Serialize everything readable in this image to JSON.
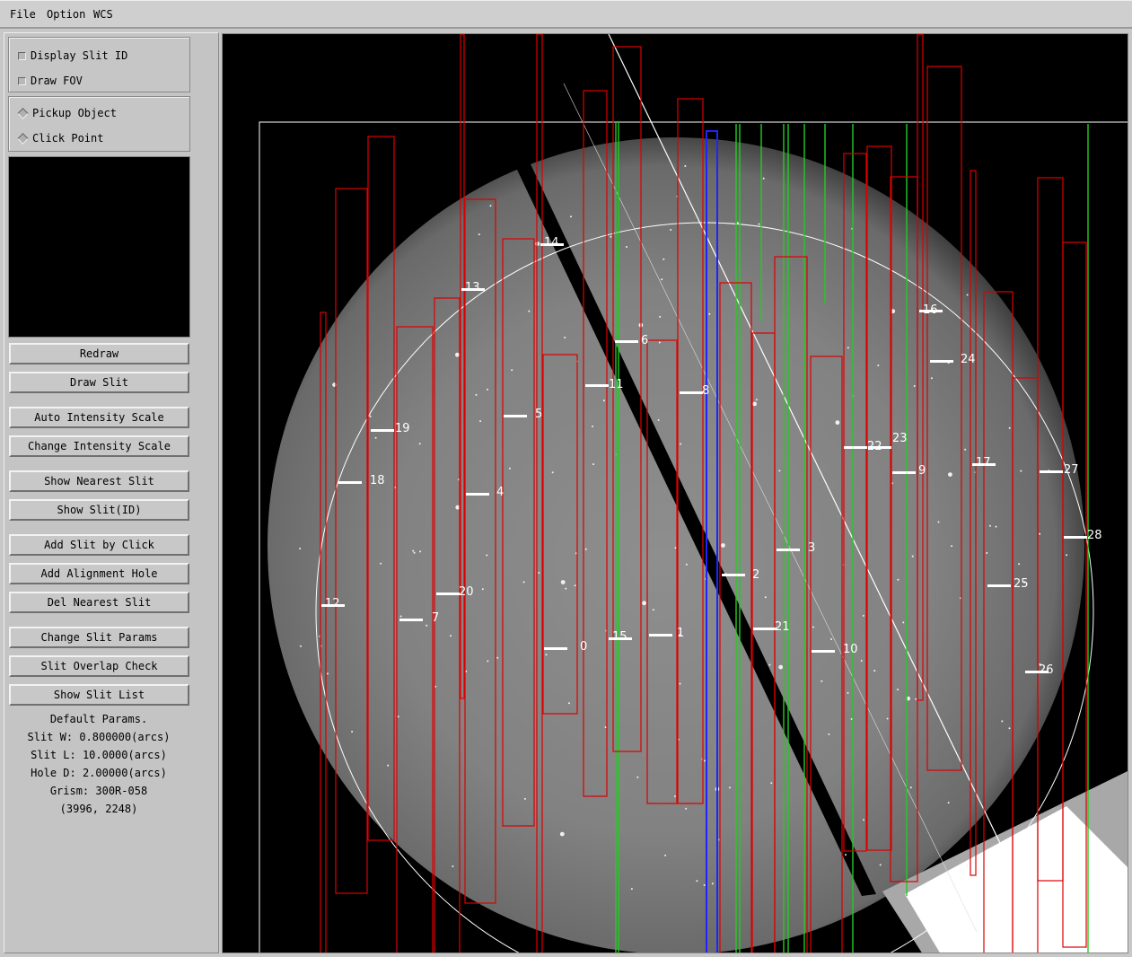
{
  "menu": [
    "File",
    "Option",
    "WCS"
  ],
  "options": {
    "display_slit_id": "Display Slit ID",
    "draw_fov": "Draw FOV",
    "pickup_object": "Pickup Object",
    "click_point": "Click Point"
  },
  "buttons": {
    "redraw": "Redraw",
    "draw_slit": "Draw Slit",
    "auto_intensity": "Auto Intensity Scale",
    "change_intensity": "Change Intensity Scale",
    "show_nearest": "Show Nearest Slit",
    "show_slit_id": "Show Slit(ID)",
    "add_slit_click": "Add Slit by Click",
    "add_alignment": "Add Alignment Hole",
    "del_nearest": "Del Nearest Slit",
    "change_params": "Change Slit Params",
    "overlap_check": "Slit Overlap Check",
    "show_list": "Show Slit List"
  },
  "params": {
    "heading": "Default Params.",
    "slit_w": "Slit W: 0.800000(arcs)",
    "slit_l": "Slit L: 10.0000(arcs)",
    "hole_d": "Hole D: 2.00000(arcs)",
    "grism": "Grism: 300R-058",
    "coords": "(3996, 2248)"
  },
  "slit_labels": [
    "0",
    "1",
    "2",
    "3",
    "4",
    "5",
    "6",
    "7",
    "8",
    "9",
    "10",
    "11",
    "12",
    "13",
    "14",
    "15",
    "16",
    "17",
    "18",
    "19",
    "20",
    "21",
    "22",
    "23",
    "24",
    "25",
    "26",
    "27",
    "28"
  ],
  "colors": {
    "slit_box": "#dd0000",
    "highlight_slit": "#2222ff",
    "green_slit": "#22cc22",
    "fov": "#ffffff"
  }
}
